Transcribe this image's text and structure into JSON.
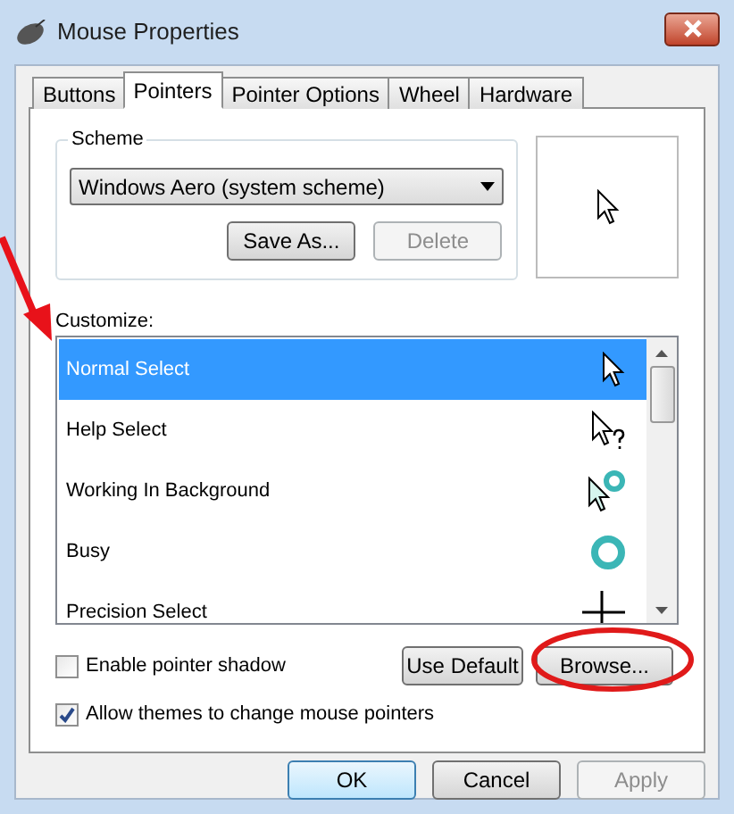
{
  "window": {
    "title": "Mouse Properties"
  },
  "tabs": [
    {
      "label": "Buttons",
      "selected": false
    },
    {
      "label": "Pointers",
      "selected": true
    },
    {
      "label": "Pointer Options",
      "selected": false
    },
    {
      "label": "Wheel",
      "selected": false
    },
    {
      "label": "Hardware",
      "selected": false
    }
  ],
  "scheme": {
    "label": "Scheme",
    "value": "Windows Aero (system scheme)",
    "buttons": [
      {
        "label": "Save As...",
        "disabled": false
      },
      {
        "label": "Delete",
        "disabled": true
      }
    ]
  },
  "customize": {
    "label": "Customize:",
    "rows": [
      {
        "name": "Normal Select",
        "kind": "arrow",
        "selected": true
      },
      {
        "name": "Help Select",
        "kind": "help",
        "selected": false
      },
      {
        "name": "Working In Background",
        "kind": "working",
        "selected": false
      },
      {
        "name": "Busy",
        "kind": "busy",
        "selected": false
      },
      {
        "name": "Precision Select",
        "kind": "cross",
        "selected": false
      }
    ]
  },
  "options": [
    {
      "label": "Enable pointer shadow",
      "checked": false
    },
    {
      "label": "Allow themes to change mouse pointers",
      "checked": true
    }
  ],
  "row_buttons": [
    "Use Default",
    "Browse..."
  ],
  "dialog_buttons": [
    {
      "label": "OK",
      "kind": "default",
      "disabled": false
    },
    {
      "label": "Cancel",
      "kind": "normal",
      "disabled": false
    },
    {
      "label": "Apply",
      "kind": "normal",
      "disabled": true
    }
  ]
}
